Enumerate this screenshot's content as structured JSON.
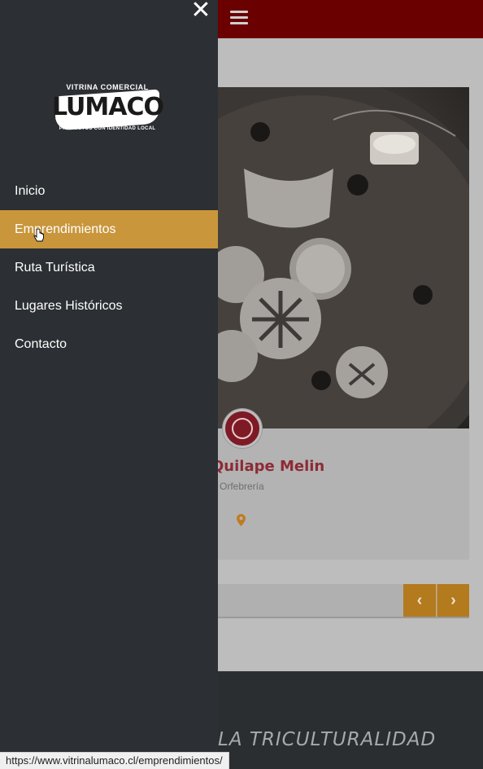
{
  "header": {
    "menu_icon": "hamburger-icon",
    "bar_color": "#6b0000"
  },
  "drawer": {
    "close_icon": "close-icon",
    "logo": {
      "top": "VITRINA COMERCIAL",
      "main": "LUMACO",
      "sub": "PRODUCTOS CON IDENTIDAD LOCAL"
    },
    "items": [
      {
        "label": "Inicio"
      },
      {
        "label": "Emprendimientos"
      },
      {
        "label": "Ruta Turística"
      },
      {
        "label": "Lugares Históricos"
      },
      {
        "label": "Contacto"
      }
    ],
    "active_color": "#c9963c"
  },
  "card": {
    "title": "Quilape Melin",
    "category": "Orfebrería",
    "location_icon": "map-pin-icon"
  },
  "pager": {
    "prev_icon": "chevron-left-icon",
    "next_icon": "chevron-right-icon",
    "prev_glyph": "‹",
    "next_glyph": "›",
    "accent": "#b37a1e"
  },
  "footer": {
    "motto": "LA TRICULTURALIDAD"
  },
  "status_bar": {
    "url": "https://www.vitrinalumaco.cl/emprendimientos/"
  }
}
